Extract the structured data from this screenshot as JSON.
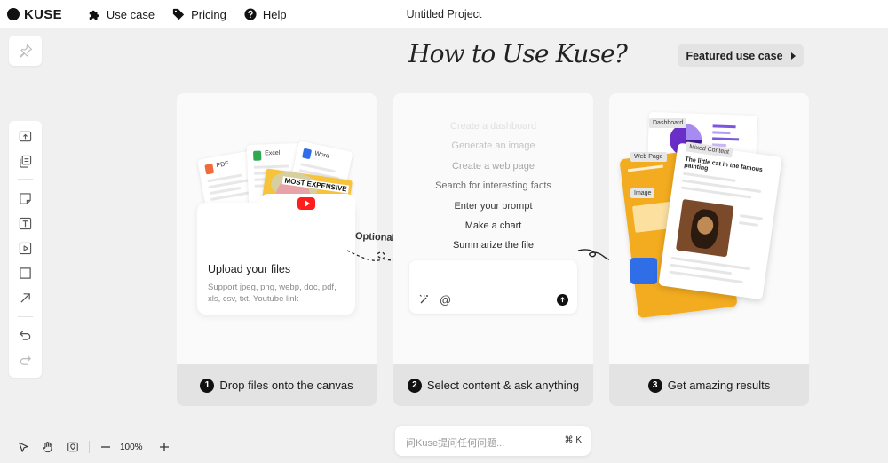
{
  "topbar": {
    "logo_text": "KUSE",
    "nav": [
      {
        "label": "Use case",
        "icon": "puzzle-icon"
      },
      {
        "label": "Pricing",
        "icon": "tag-icon"
      },
      {
        "label": "Help",
        "icon": "help-icon"
      }
    ],
    "project_title": "Untitled Project"
  },
  "canvas": {
    "heading": "How to Use Kuse?",
    "featured_button": "Featured use case",
    "cards": [
      {
        "step": "1",
        "footer": "Drop files onto the canvas",
        "upload_title": "Upload your files",
        "upload_sub": "Support jpeg, png, webp, doc, pdf, xls, csv, txt, Youtube link",
        "doc_labels": [
          "PDF",
          "Excel",
          "Word"
        ],
        "poster_text": "MOST EXPENSIVE"
      },
      {
        "step": "2",
        "footer": "Select content & ask anything",
        "prompts": [
          "Create a dashboard",
          "Generate an image",
          "Create a web page",
          "Search for interesting facts",
          "Enter your prompt",
          "Make a chart",
          "Summarize the file"
        ],
        "at_symbol": "@"
      },
      {
        "step": "3",
        "footer": "Get amazing results",
        "chips": [
          "Dashboard",
          "Web Page",
          "Image",
          "Mixed Content"
        ],
        "mixed_title": "The little cat in the famous painting"
      }
    ],
    "optional_label": "Optional"
  },
  "bottom": {
    "zoom": "100%",
    "ask_placeholder": "问Kuse提问任何问题...",
    "ask_shortcut": "⌘ K"
  },
  "colors": {
    "background": "#f0f0f0",
    "card": "#fafafa",
    "footer": "#e3e3e3",
    "accent_yellow": "#f3ab1f",
    "accent_blue": "#2f6ee6"
  }
}
